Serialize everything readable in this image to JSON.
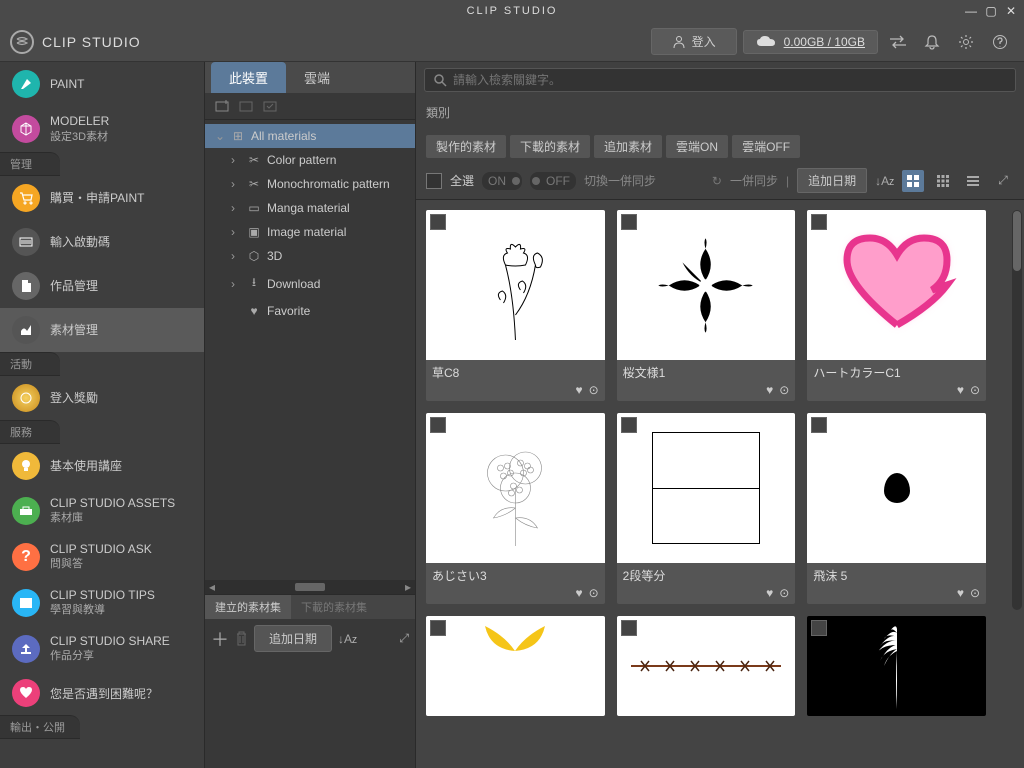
{
  "titlebar": {
    "title": "CLIP STUDIO"
  },
  "topbar": {
    "brand": "CLIP STUDIO",
    "login": "登入",
    "storage": "0.00GB / 10GB"
  },
  "sidebar": {
    "paint": "PAINT",
    "modeler": "MODELER",
    "modeler_sub": "設定3D素材",
    "section_manage": "管理",
    "buy": "購買・申請PAINT",
    "activation": "輸入啟動碼",
    "works": "作品管理",
    "materials": "素材管理",
    "section_activity": "活動",
    "login_reward": "登入獎勵",
    "section_service": "服務",
    "basic_course": "基本使用講座",
    "assets": "CLIP STUDIO ASSETS",
    "assets_sub": "素材庫",
    "ask": "CLIP STUDIO ASK",
    "ask_sub": "問與答",
    "tips": "CLIP STUDIO TIPS",
    "tips_sub": "學習與教導",
    "share": "CLIP STUDIO SHARE",
    "share_sub": "作品分享",
    "trouble": "您是否遇到困難呢？",
    "section_export": "輸出・公開"
  },
  "middle": {
    "tab_device": "此裝置",
    "tab_cloud": "雲端",
    "tree": {
      "root": "All materials",
      "color_pattern": "Color pattern",
      "mono_pattern": "Monochromatic pattern",
      "manga": "Manga material",
      "image": "Image material",
      "three_d": "3D",
      "download": "Download",
      "favorite": "Favorite"
    },
    "btab_created": "建立的素材集",
    "btab_downloaded": "下載的素材集",
    "sort": "追加日期"
  },
  "content": {
    "search_placeholder": "請輸入檢索關鍵字。",
    "category_label": "類別",
    "filters": {
      "created": "製作的素材",
      "downloaded": "下載的素材",
      "additional": "追加素材",
      "cloud_on": "雲端ON",
      "cloud_off": "雲端OFF"
    },
    "select_all": "全選",
    "toggle_on": "ON",
    "toggle_off": "OFF",
    "switch_sync": "切換一併同步",
    "batch_sync": "一併同步",
    "sort_by": "追加日期",
    "items": [
      {
        "name": "草C8"
      },
      {
        "name": "桜文様1"
      },
      {
        "name": "ハートカラーC1"
      },
      {
        "name": "あじさい3"
      },
      {
        "name": "2段等分"
      },
      {
        "name": "飛沫 5"
      },
      {
        "name": ""
      },
      {
        "name": ""
      },
      {
        "name": ""
      }
    ]
  }
}
